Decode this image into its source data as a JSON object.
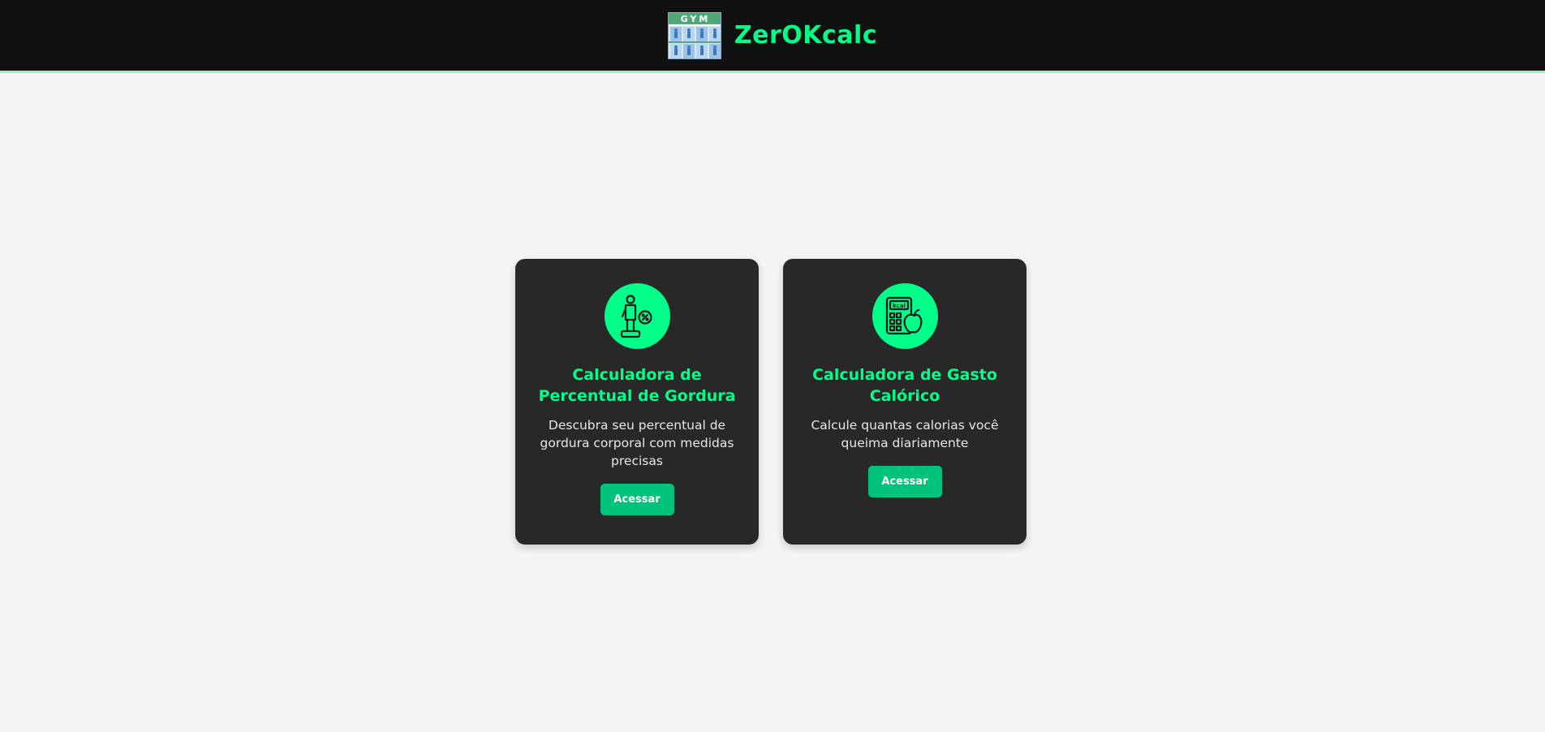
{
  "header": {
    "brand_name": "ZerOKcalc",
    "logo": {
      "icon": "gym-logo-icon",
      "text": "GYM"
    }
  },
  "cards": [
    {
      "icon": "body-fat-scale-icon",
      "title": "Calculadora de Percentual de Gordura",
      "description": "Descubra seu percentual de gordura corporal com medidas precisas",
      "button_label": "Acessar"
    },
    {
      "icon": "calorie-calculator-icon",
      "title": "Calculadora de Gasto Calórico",
      "description": "Calcule quantas calorias você queima diariamente",
      "button_label": "Acessar"
    }
  ],
  "colors": {
    "accent": "#00ff88",
    "button": "#00c27a",
    "header_bg": "#111111",
    "card_bg": "#282828",
    "page_bg": "#f4f4f4"
  }
}
